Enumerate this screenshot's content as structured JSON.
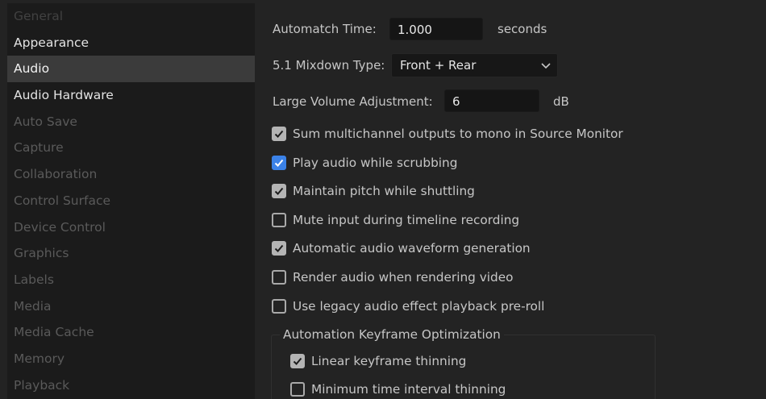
{
  "sidebar": {
    "items": [
      {
        "label": "General",
        "state": "faded"
      },
      {
        "label": "Appearance",
        "state": "bright"
      },
      {
        "label": "Audio",
        "state": "selected"
      },
      {
        "label": "Audio Hardware",
        "state": "bright"
      },
      {
        "label": "Auto Save",
        "state": "dim"
      },
      {
        "label": "Capture",
        "state": "dim"
      },
      {
        "label": "Collaboration",
        "state": "dim"
      },
      {
        "label": "Control Surface",
        "state": "dim"
      },
      {
        "label": "Device Control",
        "state": "dim"
      },
      {
        "label": "Graphics",
        "state": "dim"
      },
      {
        "label": "Labels",
        "state": "dim"
      },
      {
        "label": "Media",
        "state": "dim"
      },
      {
        "label": "Media Cache",
        "state": "dim"
      },
      {
        "label": "Memory",
        "state": "dim"
      },
      {
        "label": "Playback",
        "state": "dim"
      }
    ]
  },
  "audio": {
    "automatch": {
      "label": "Automatch Time:",
      "value": "1.000",
      "unit": "seconds"
    },
    "mixdown": {
      "label": "5.1 Mixdown Type:",
      "value": "Front + Rear",
      "icon": "chevron-down-icon"
    },
    "volume": {
      "label": "Large Volume Adjustment:",
      "value": "6",
      "unit": "dB"
    },
    "options": [
      {
        "label": "Sum multichannel outputs to mono in Source Monitor",
        "checked": true,
        "style": "gray"
      },
      {
        "label": "Play audio while scrubbing",
        "checked": true,
        "style": "blue"
      },
      {
        "label": "Maintain pitch while shuttling",
        "checked": true,
        "style": "gray"
      },
      {
        "label": "Mute input during timeline recording",
        "checked": false,
        "style": "none"
      },
      {
        "label": "Automatic audio waveform generation",
        "checked": true,
        "style": "gray"
      },
      {
        "label": "Render audio when rendering video",
        "checked": false,
        "style": "none"
      },
      {
        "label": "Use legacy audio effect playback pre-roll",
        "checked": false,
        "style": "none"
      }
    ],
    "keyframe_group": {
      "title": "Automation Keyframe Optimization",
      "options": [
        {
          "label": "Linear keyframe thinning",
          "checked": true,
          "style": "gray"
        },
        {
          "label": "Minimum time interval thinning",
          "checked": false,
          "style": "none"
        }
      ]
    }
  },
  "colors": {
    "background": "#232323",
    "sidebar": "#1b1b1b",
    "selected": "#3b3b3b",
    "accent_blue": "#3b82e8",
    "check_gray": "#b4b4b4"
  }
}
